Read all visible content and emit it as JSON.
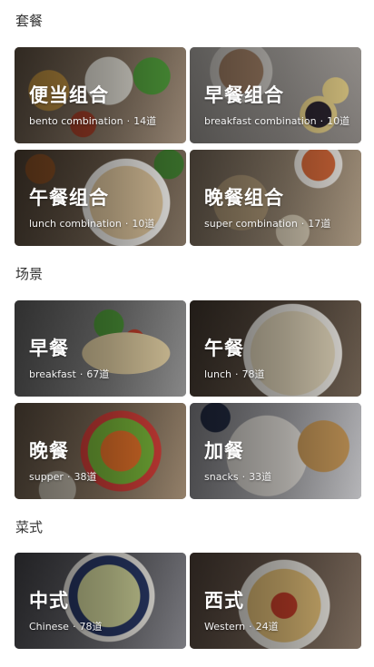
{
  "sections": [
    {
      "title": "套餐",
      "cards": [
        {
          "title": "便当组合",
          "subtitle": "bento combination",
          "count": "14道"
        },
        {
          "title": "早餐组合",
          "subtitle": "breakfast combination",
          "count": "10道"
        },
        {
          "title": "午餐组合",
          "subtitle": "lunch combination",
          "count": "10道"
        },
        {
          "title": "晚餐组合",
          "subtitle": "super combination",
          "count": "17道"
        }
      ]
    },
    {
      "title": "场景",
      "cards": [
        {
          "title": "早餐",
          "subtitle": "breakfast",
          "count": "67道"
        },
        {
          "title": "午餐",
          "subtitle": "lunch",
          "count": "78道"
        },
        {
          "title": "晚餐",
          "subtitle": "supper",
          "count": "38道"
        },
        {
          "title": "加餐",
          "subtitle": "snacks",
          "count": "33道"
        }
      ]
    },
    {
      "title": "菜式",
      "cards": [
        {
          "title": "中式",
          "subtitle": "Chinese",
          "count": "78道"
        },
        {
          "title": "西式",
          "subtitle": "Western",
          "count": "24道"
        }
      ]
    }
  ],
  "separator": "·"
}
